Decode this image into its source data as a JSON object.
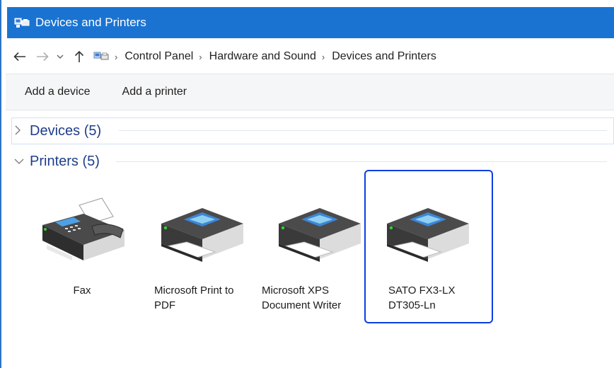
{
  "window": {
    "title": "Devices and Printers",
    "accent_color": "#1a73d1",
    "icon": "devices-and-printers-icon"
  },
  "address_bar": {
    "back_icon": "arrow-left-icon",
    "forward_icon": "arrow-right-icon",
    "recent_icon": "chevron-down-icon",
    "up_icon": "arrow-up-icon",
    "breadcrumbs": [
      "Control Panel",
      "Hardware and Sound",
      "Devices and Printers"
    ]
  },
  "toolbar": {
    "add_device_label": "Add a device",
    "add_printer_label": "Add a printer"
  },
  "groups": {
    "devices": {
      "label": "Devices (5)",
      "expanded": false
    },
    "printers": {
      "label": "Printers (5)",
      "expanded": true
    }
  },
  "printers": [
    {
      "name": "Fax",
      "icon": "fax-icon",
      "selected": false
    },
    {
      "name_line1": "Microsoft Print to",
      "name_line2": "PDF",
      "icon": "printer-icon",
      "selected": false
    },
    {
      "name_line1": "Microsoft XPS",
      "name_line2": "Document Writer",
      "icon": "printer-icon",
      "selected": false
    },
    {
      "name_line1": "SATO FX3-LX",
      "name_line2": "DT305-Ln",
      "icon": "printer-icon",
      "selected": true
    }
  ]
}
